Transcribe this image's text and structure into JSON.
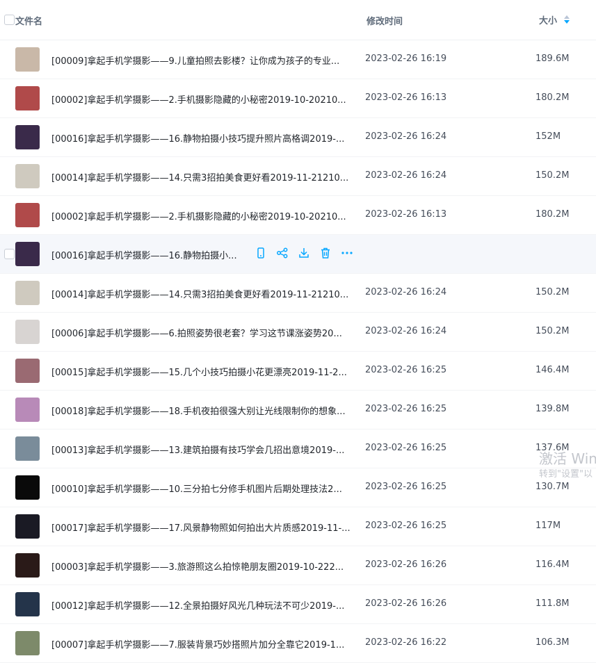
{
  "header": {
    "name_label": "文件名",
    "time_label": "修改时间",
    "size_label": "大小",
    "sort_icon": "sort-desc-icon"
  },
  "colors": {
    "accent": "#06a7ff",
    "row_hover": "#f5f7fb",
    "text": "#1f2329",
    "muted": "#5f6b7a"
  },
  "files": [
    {
      "name": "[00009]拿起手机学摄影——9.儿童拍照去影楼？让你成为孩子的专业...",
      "time": "2023-02-26 16:19",
      "size": "189.6M",
      "thumb": "#c9b8a8"
    },
    {
      "name": "[00002]拿起手机学摄影——2.手机摄影隐藏的小秘密2019-10-20210...",
      "time": "2023-02-26 16:13",
      "size": "180.2M",
      "thumb": "#b04a4a"
    },
    {
      "name": "[00016]拿起手机学摄影——16.静物拍摄小技巧提升照片高格调2019-...",
      "time": "2023-02-26 16:24",
      "size": "152M",
      "thumb": "#3a2a4a"
    },
    {
      "name": "[00014]拿起手机学摄影——14.只需3招拍美食更好看2019-11-21210...",
      "time": "2023-02-26 16:24",
      "size": "150.2M",
      "thumb": "#cfcabf"
    },
    {
      "name": "[00002]拿起手机学摄影——2.手机摄影隐藏的小秘密2019-10-20210...",
      "time": "2023-02-26 16:13",
      "size": "180.2M",
      "thumb": "#b04a4a"
    },
    {
      "name": "[00016]拿起手机学摄影——16.静物拍摄小...",
      "time": "",
      "size": "",
      "thumb": "#3a2a4a",
      "hovered": true
    },
    {
      "name": "[00014]拿起手机学摄影——14.只需3招拍美食更好看2019-11-21210...",
      "time": "2023-02-26 16:24",
      "size": "150.2M",
      "thumb": "#cfcabf"
    },
    {
      "name": "[00006]拿起手机学摄影——6.拍照姿势很老套？学习这节课涨姿势20...",
      "time": "2023-02-26 16:24",
      "size": "150.2M",
      "thumb": "#d8d4d2"
    },
    {
      "name": "[00015]拿起手机学摄影——15.几个小技巧拍摄小花更漂亮2019-11-2...",
      "time": "2023-02-26 16:25",
      "size": "146.4M",
      "thumb": "#9a6a72"
    },
    {
      "name": "[00018]拿起手机学摄影——18.手机夜拍很强大别让光线限制你的想象...",
      "time": "2023-02-26 16:25",
      "size": "139.8M",
      "thumb": "#b88ab8"
    },
    {
      "name": "[00013]拿起手机学摄影——13.建筑拍摄有技巧学会几招出意境2019-...",
      "time": "2023-02-26 16:25",
      "size": "137.6M",
      "thumb": "#7a8c9a"
    },
    {
      "name": "[00010]拿起手机学摄影——10.三分拍七分修手机图片后期处理技法2...",
      "time": "2023-02-26 16:25",
      "size": "130.7M",
      "thumb": "#0a0a0a"
    },
    {
      "name": "[00017]拿起手机学摄影——17.风景静物照如何拍出大片质感2019-11-...",
      "time": "2023-02-26 16:25",
      "size": "117M",
      "thumb": "#1a1a24"
    },
    {
      "name": "[00003]拿起手机学摄影——3.旅游照这么拍惊艳朋友圈2019-10-222...",
      "time": "2023-02-26 16:26",
      "size": "116.4M",
      "thumb": "#2a1a18"
    },
    {
      "name": "[00012]拿起手机学摄影——12.全景拍摄好风光几种玩法不可少2019-...",
      "time": "2023-02-26 16:26",
      "size": "111.8M",
      "thumb": "#24344a"
    },
    {
      "name": "[00007]拿起手机学摄影——7.服装背景巧妙搭照片加分全靠它2019-1...",
      "time": "2023-02-26 16:22",
      "size": "106.3M",
      "thumb": "#7d8a6a"
    }
  ],
  "row_actions": [
    "phone-icon",
    "share-icon",
    "download-icon",
    "delete-icon",
    "more-icon"
  ],
  "watermark": {
    "line1": "激活 Win",
    "line2": "转到\"设置\"以"
  }
}
